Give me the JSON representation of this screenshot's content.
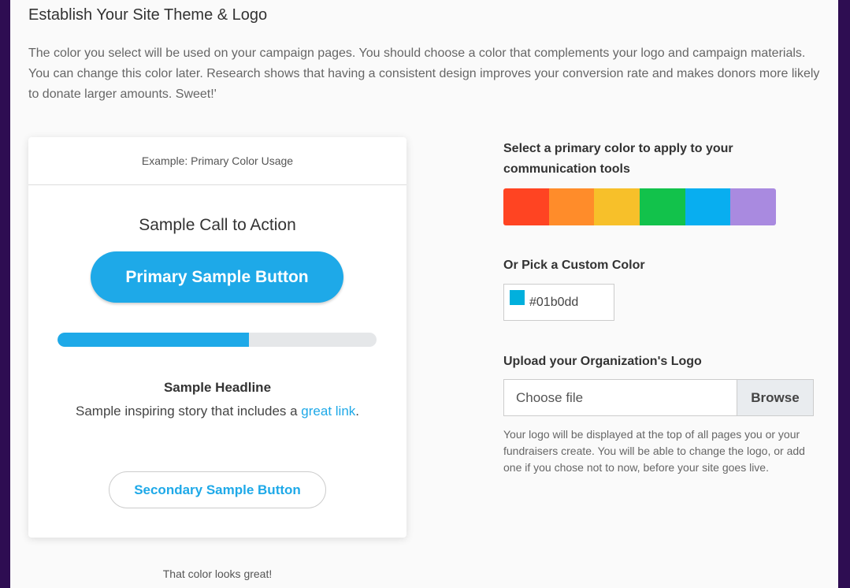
{
  "section": {
    "title": "Establish Your Site Theme & Logo",
    "intro": "The color you select will be used on your campaign pages. You should choose a color that complements your logo and campaign materials. You can change this color later. Research shows that having a consistent design improves your conversion rate and makes donors more likely to donate larger amounts. Sweet!'"
  },
  "preview_card": {
    "header": "Example: Primary Color Usage",
    "cta_title": "Sample Call to Action",
    "primary_button_label": "Primary Sample Button",
    "progress_fraction": 0.6,
    "headline": "Sample Headline",
    "story_text": "Sample inspiring story that includes a ",
    "story_link": "great link",
    "story_end": ".",
    "secondary_button_label": "Secondary Sample Button",
    "accent_color": "#1ea9e8"
  },
  "below_card_text": "That color looks great!",
  "color_picker": {
    "label": "Select a primary color to apply to your communication tools",
    "swatches": [
      {
        "name": "red",
        "color": "#ff4422"
      },
      {
        "name": "orange",
        "color": "#ff8c2a"
      },
      {
        "name": "yellow",
        "color": "#f7c02a"
      },
      {
        "name": "green",
        "color": "#12c24b"
      },
      {
        "name": "blue",
        "color": "#08aef0"
      },
      {
        "name": "purple",
        "color": "#a98ae0"
      }
    ]
  },
  "custom_color": {
    "label": "Or Pick a Custom Color",
    "value": "#01b0dd",
    "chip_color": "#01b0dd"
  },
  "logo_upload": {
    "label": "Upload your Organization's Logo",
    "placeholder": "Choose file",
    "browse_label": "Browse",
    "help": "Your logo will be displayed at the top of all pages you or your fundraisers create. You will be able to change the logo, or add one if you chose not to now, before your site goes live."
  }
}
